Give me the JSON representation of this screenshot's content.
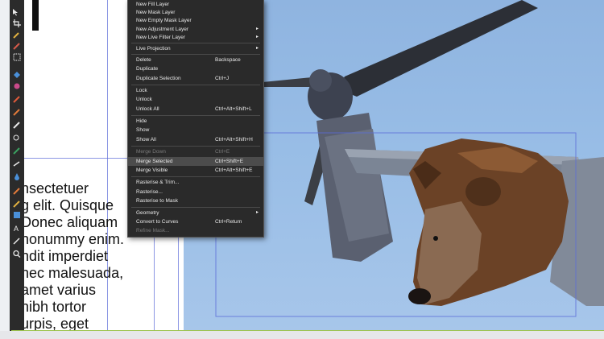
{
  "context_menu": {
    "items": [
      {
        "label": "New Fill Layer",
        "shortcut": "",
        "submenu": false,
        "disabled": false
      },
      {
        "label": "New Mask Layer",
        "shortcut": "",
        "submenu": false,
        "disabled": false
      },
      {
        "label": "New Empty Mask Layer",
        "shortcut": "",
        "submenu": false,
        "disabled": false
      },
      {
        "label": "New Adjustment Layer",
        "shortcut": "",
        "submenu": true,
        "disabled": false
      },
      {
        "label": "New Live Filter Layer",
        "shortcut": "",
        "submenu": true,
        "disabled": false
      },
      {
        "label": "Live Projection",
        "shortcut": "",
        "submenu": true,
        "disabled": false
      },
      {
        "label": "Delete",
        "shortcut": "Backspace",
        "submenu": false,
        "disabled": false
      },
      {
        "label": "Duplicate",
        "shortcut": "",
        "submenu": false,
        "disabled": false
      },
      {
        "label": "Duplicate Selection",
        "shortcut": "Ctrl+J",
        "submenu": false,
        "disabled": false
      },
      {
        "label": "Lock",
        "shortcut": "",
        "submenu": false,
        "disabled": false
      },
      {
        "label": "Unlock",
        "shortcut": "",
        "submenu": false,
        "disabled": false
      },
      {
        "label": "Unlock All",
        "shortcut": "Ctrl+Alt+Shift+L",
        "submenu": false,
        "disabled": false
      },
      {
        "label": "Hide",
        "shortcut": "",
        "submenu": false,
        "disabled": false
      },
      {
        "label": "Show",
        "shortcut": "",
        "submenu": false,
        "disabled": false
      },
      {
        "label": "Show All",
        "shortcut": "Ctrl+Alt+Shift+H",
        "submenu": false,
        "disabled": false
      },
      {
        "label": "Merge Down",
        "shortcut": "Ctrl+E",
        "submenu": false,
        "disabled": true
      },
      {
        "label": "Merge Selected",
        "shortcut": "Ctrl+Shift+E",
        "submenu": false,
        "disabled": false,
        "highlighted": true
      },
      {
        "label": "Merge Visible",
        "shortcut": "Ctrl+Alt+Shift+E",
        "submenu": false,
        "disabled": false
      },
      {
        "label": "Rasterise & Trim...",
        "shortcut": "",
        "submenu": false,
        "disabled": false
      },
      {
        "label": "Rasterise...",
        "shortcut": "",
        "submenu": false,
        "disabled": false
      },
      {
        "label": "Rasterise to Mask",
        "shortcut": "",
        "submenu": false,
        "disabled": false
      },
      {
        "label": "Geometry",
        "shortcut": "",
        "submenu": true,
        "disabled": false
      },
      {
        "label": "Convert to Curves",
        "shortcut": "Ctrl+Return",
        "submenu": false,
        "disabled": false
      },
      {
        "label": "Refine Mask...",
        "shortcut": "",
        "submenu": false,
        "disabled": true
      }
    ],
    "submenu_arrow": "▸"
  },
  "document_text": {
    "lines": [
      "nsectetuer",
      "g elit. Quisque",
      "Donec aliquam",
      "nonummy enim.",
      "ndit imperdiet",
      "nec malesuada,",
      "amet varius",
      "nibh tortor",
      "urpis, eget"
    ]
  },
  "toolbar": {
    "tools": [
      "move-tool-icon",
      "view-tool-icon",
      "crop-tool-icon",
      "color-picker-icon",
      "paint-brush-icon",
      "vector-brush-icon",
      "selection-tool-icon",
      "fill-tool-icon",
      "gradient-tool-icon",
      "pen-tool-icon",
      "pixel-tool-icon",
      "erase-tool-icon",
      "clone-tool-icon",
      "retouch-tool-icon",
      "blur-tool-icon",
      "smudge-tool-icon",
      "dodge-tool-icon",
      "burn-tool-icon",
      "sponge-tool-icon",
      "node-tool-icon",
      "shape-tool-icon",
      "text-tool-icon",
      "frame-text-icon",
      "zoom-tool-icon"
    ]
  },
  "colors": {
    "menu_bg": "#2a2a2a",
    "menu_text": "#e8e8e8",
    "menu_disabled": "#7a7a7a",
    "menu_highlight": "#4c4c4c",
    "guide": "#5b6bd8",
    "sky": "#98bde6",
    "toolbar": "#2b2b2b"
  }
}
